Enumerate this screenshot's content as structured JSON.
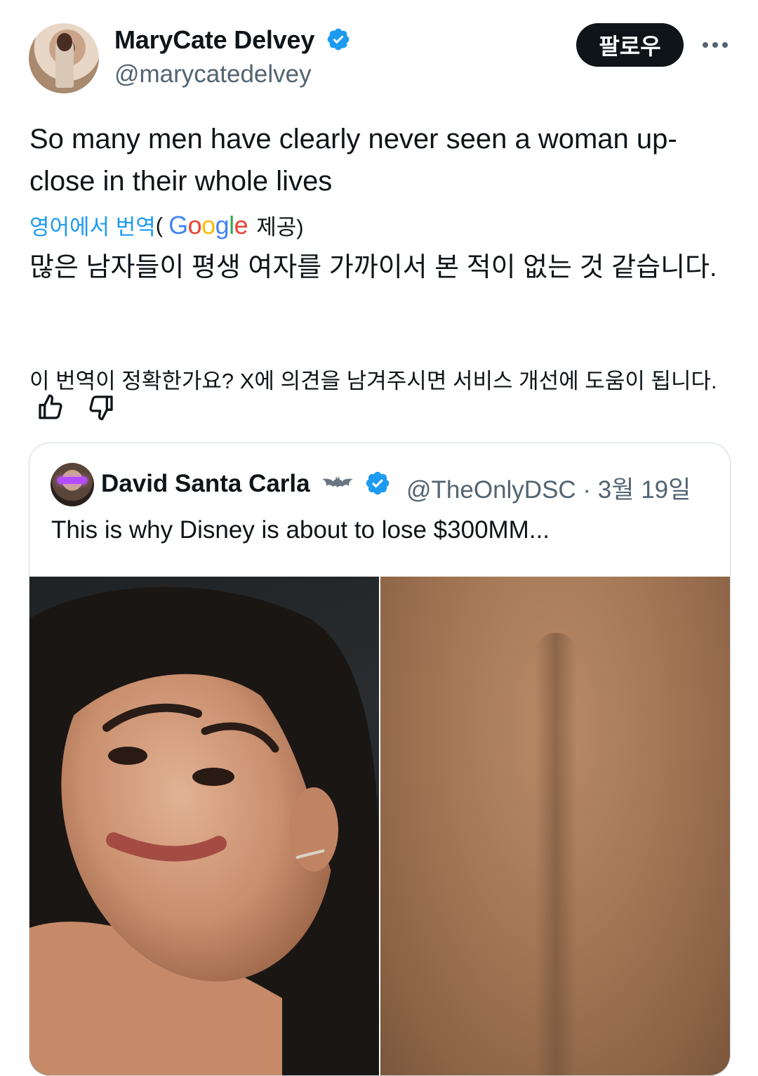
{
  "author": {
    "display_name": "MaryCate Delvey",
    "handle": "@marycatedelvey",
    "verified": true,
    "avatar_icon": "profile-photo"
  },
  "actions": {
    "follow_label": "팔로우",
    "more_icon": "more-dots-icon"
  },
  "tweet": {
    "text": "So many men have clearly never seen a woman up-close in their whole lives"
  },
  "translation": {
    "link_label": "영어에서 번역",
    "provider_open": "(",
    "provider_name": "Google",
    "provider_close": " 제공)",
    "translated_text": "많은 남자들이 평생 여자를 가까이서 본 적이 없는 것 같습니다.",
    "feedback_prompt": "이 번역이 정확한가요? X에 의견을 남겨주시면 서비스 개선에 도움이 됩니다."
  },
  "quote": {
    "display_name": "David Santa Carla",
    "name_emoji_icon": "bat-icon",
    "verified": true,
    "handle_and_date": "@TheOnlyDSC · 3월 19일",
    "text": "This is why Disney is about to lose $300MM...",
    "media": [
      "portrait-photo",
      "back-skin-photo"
    ]
  },
  "colors": {
    "accent": "#1d9bf0",
    "text": "#0f1419",
    "secondary": "#536471",
    "border": "#cfd9de"
  }
}
